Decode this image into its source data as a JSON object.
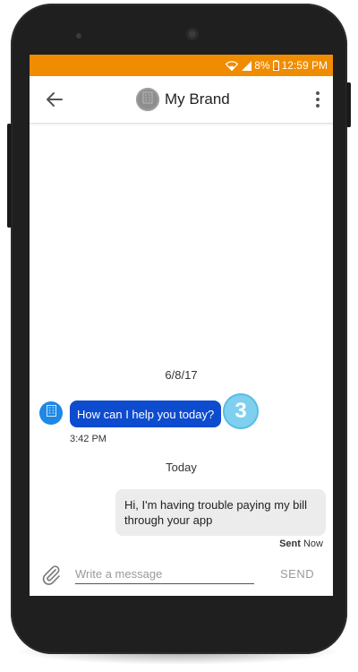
{
  "status_bar": {
    "battery_percent": "8%",
    "time": "12:59 PM",
    "icons": [
      "wifi-icon",
      "signal-icon",
      "battery-icon"
    ],
    "background_color": "#f08c00"
  },
  "app_bar": {
    "title": "My Brand",
    "back_icon": "arrow-left-icon",
    "menu_icon": "more-vert-icon",
    "avatar_icon": "building-icon"
  },
  "conversation": {
    "date_separator": "6/8/17",
    "incoming": {
      "text": "How can I help you today?",
      "time": "3:42 PM",
      "bubble_color": "#0d4bcf",
      "avatar_icon": "building-icon"
    },
    "badge": "3",
    "today_separator": "Today",
    "outgoing": {
      "text": "Hi, I'm having trouble paying my bill through your app",
      "status": "Sent",
      "time": "Now",
      "bubble_color": "#ececec"
    }
  },
  "composer": {
    "placeholder": "Write a message",
    "value": "",
    "send_label": "SEND",
    "attach_icon": "paperclip-icon"
  }
}
